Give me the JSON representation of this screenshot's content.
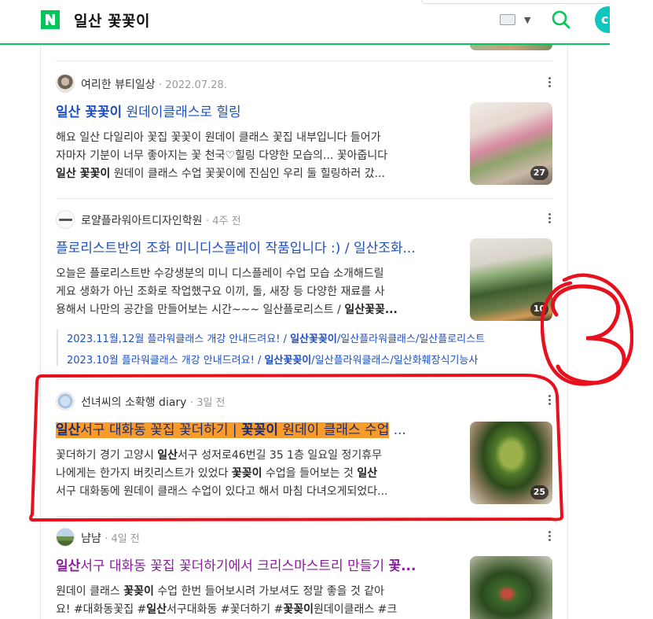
{
  "header": {
    "title": "일산 꽃꽃이",
    "logo_letter": "N",
    "brand_color": "#03c75a",
    "avatar_letter": "c"
  },
  "results": [
    {
      "source": "여리한 뷰티일상",
      "date": "2022.07.28.",
      "title_parts": [
        {
          "t": "일산 꽃꽃이",
          "b": true
        },
        {
          "t": " 원데이클래스로 힐링",
          "b": false
        }
      ],
      "desc_lines": [
        [
          {
            "t": "해요 일산 다일리아 꽃집 꽃꽃이 원데이 클래스 꽃집 내부입니다 들어가",
            "b": false
          }
        ],
        [
          {
            "t": "자마자 기분이 너무 좋아지는 꽃 천국♡힐링 다양한 모습의... 꽃아줍니다",
            "b": false
          }
        ],
        [
          {
            "t": "일산 꽃꽃이",
            "b": true
          },
          {
            "t": " 원데이 클래스 수업 꽃꽃이에 진심인 우리 둘 힐링하러 갔...",
            "b": false
          }
        ]
      ],
      "image_count": "27"
    },
    {
      "source": "로얄플라워아트디자인학원",
      "date": "4주 전",
      "title_parts": [
        {
          "t": "플로리스트반의 조화 미니디스플레이 작품입니다 :) / 일산조화...",
          "b": false
        }
      ],
      "desc_lines": [
        [
          {
            "t": "오늘은 플로리스트반 수강생분의 미니 디스플레이 수업 모습 소개해드릴",
            "b": false
          }
        ],
        [
          {
            "t": "게요 생화가 아닌 조화로 작업했구요 이끼, 돌, 새장 등 다양한 재료를 사",
            "b": false
          }
        ],
        [
          {
            "t": "용해서 나만의 공간을 만들어보는 시간~~~ 일산플로리스트 / ",
            "b": false
          },
          {
            "t": "일산꽃꽂...",
            "b": true
          }
        ]
      ],
      "image_count": "10",
      "sublinks": [
        [
          {
            "t": "2023.11월,12월 플라워클래스 개강 안내드려요! / ",
            "b": false
          },
          {
            "t": "일산꽃꽂이",
            "b": true
          },
          {
            "t": "/일산플라워클래스/일산플로리스트",
            "b": false
          }
        ],
        [
          {
            "t": "2023.10월 플라워클래스 개강 안내드려요! / ",
            "b": false
          },
          {
            "t": "일산꽃꽂이",
            "b": true
          },
          {
            "t": "/일산플라워클래스/일산화훼장식기능사",
            "b": false
          }
        ]
      ]
    },
    {
      "source": "선녀씨의 소확행 diary",
      "date": "3일 전",
      "title_parts": [
        {
          "t": "일산",
          "b": true,
          "hl": true
        },
        {
          "t": "서구 대화동 꽃집 꽃더하기 | ",
          "b": false,
          "hl": true
        },
        {
          "t": "꽃꽂이",
          "b": true,
          "hl": true
        },
        {
          "t": " 원데이 클래스 수업",
          "b": false,
          "hl": true
        },
        {
          "t": " ...",
          "b": false,
          "hl": false
        }
      ],
      "desc_lines": [
        [
          {
            "t": "꽃더하기 경기 고양시 ",
            "b": false
          },
          {
            "t": "일산",
            "b": true
          },
          {
            "t": "서구 성저로46번길 35 1층 일요일 정기휴무",
            "b": false
          }
        ],
        [
          {
            "t": "나에게는 한가지 버킷리스트가 있었다 ",
            "b": false
          },
          {
            "t": "꽃꽂이",
            "b": true
          },
          {
            "t": " 수업을 들어보는 것 ",
            "b": false
          },
          {
            "t": "일산",
            "b": true
          }
        ],
        [
          {
            "t": "서구 대화동에 원데이 클래스 수업이 있다고 해서 마침 다녀오게되었다...",
            "b": false
          }
        ]
      ],
      "image_count": "25"
    },
    {
      "source": "냠냠",
      "date": "4일 전",
      "title_parts": [
        {
          "t": "일산",
          "b": true
        },
        {
          "t": "서구 대화동 꽃집 꽃더하기에서 크리스마스트리 만들기 ",
          "b": false
        },
        {
          "t": "꽃...",
          "b": true
        }
      ],
      "desc_lines": [
        [
          {
            "t": "원데이 클래스 ",
            "b": false
          },
          {
            "t": "꽃꽂이",
            "b": true
          },
          {
            "t": " 수업 한번 들어보시려 가보셔도 정말 좋을 것 같아",
            "b": false
          }
        ],
        [
          {
            "t": "요! #대화동꽃집 #",
            "b": false
          },
          {
            "t": "일산",
            "b": true
          },
          {
            "t": "서구대화동 #꽃더하기 #",
            "b": false
          },
          {
            "t": "꽃꽂이",
            "b": true
          },
          {
            "t": "원데이클래스 #크",
            "b": false
          }
        ]
      ]
    }
  ],
  "colors": {
    "link": "#1f4fbf",
    "visited": "#8a1a9f",
    "highlight": "#f99b2b",
    "annotation_red": "#e8101c"
  },
  "annotation": {
    "label": "3"
  }
}
